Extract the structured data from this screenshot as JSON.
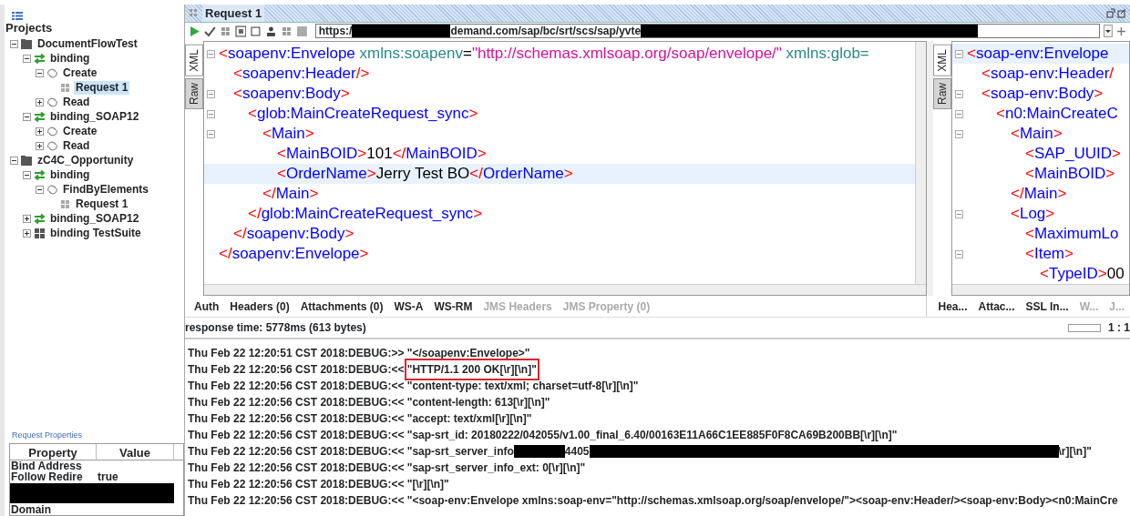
{
  "tree": {
    "title": "Projects",
    "items": [
      {
        "label": "DocumentFlowTest",
        "kind": "project",
        "expanded": true,
        "selected": false,
        "children": [
          {
            "label": "binding",
            "kind": "interface",
            "expanded": true,
            "selected": false,
            "children": [
              {
                "label": "Create",
                "kind": "operation",
                "expanded": true,
                "selected": false,
                "children": [
                  {
                    "label": "Request 1",
                    "kind": "request",
                    "selected": true
                  }
                ]
              },
              {
                "label": "Read",
                "kind": "operation",
                "expanded": false,
                "selected": false
              }
            ]
          },
          {
            "label": "binding_SOAP12",
            "kind": "interface",
            "expanded": true,
            "selected": false,
            "children": [
              {
                "label": "Create",
                "kind": "operation",
                "expanded": false,
                "selected": false
              },
              {
                "label": "Read",
                "kind": "operation",
                "expanded": false,
                "selected": false
              }
            ]
          }
        ]
      },
      {
        "label": "zC4C_Opportunity",
        "kind": "project",
        "expanded": true,
        "selected": false,
        "children": [
          {
            "label": "binding",
            "kind": "interface",
            "expanded": true,
            "selected": false,
            "children": [
              {
                "label": "FindByElements",
                "kind": "operation",
                "expanded": true,
                "selected": false,
                "children": [
                  {
                    "label": "Request 1",
                    "kind": "request",
                    "selected": false
                  }
                ]
              }
            ]
          },
          {
            "label": "binding_SOAP12",
            "kind": "interface",
            "expanded": false,
            "selected": false
          },
          {
            "label": "binding TestSuite",
            "kind": "testsuite",
            "expanded": false,
            "selected": false
          }
        ]
      }
    ]
  },
  "properties": {
    "title": "Request Properties",
    "columns": [
      "Property",
      "Value"
    ],
    "rows": [
      {
        "kind": "row",
        "property": "Bind Address"
      },
      {
        "kind": "row",
        "property": "Follow Redire",
        "value": "true"
      },
      {
        "kind": "redaction"
      },
      {
        "kind": "row",
        "property": "Domain"
      }
    ]
  },
  "request": {
    "title": "Request 1",
    "url": [
      {
        "kind": "text",
        "text": "https:/"
      },
      {
        "kind": "redaction"
      },
      {
        "kind": "text",
        "text": "demand.com/sap/bc/srt/scs/sap/yvte"
      },
      {
        "kind": "redaction"
      }
    ],
    "view_tabs": [
      {
        "label": "XML",
        "selected": true
      },
      {
        "label": "Raw",
        "selected": false
      }
    ],
    "lines": [
      {
        "current": false,
        "tokens": [
          {
            "kind": "bracket",
            "text": "<"
          },
          {
            "kind": "name",
            "text": "soapenv:Envelope"
          },
          {
            "kind": "attr",
            "text": " xmlns:soapenv"
          },
          {
            "kind": "text",
            "text": "="
          },
          {
            "kind": "value",
            "text": "\"http://schemas.xmlsoap.org/soap/envelope/\""
          },
          {
            "kind": "attr",
            "text": " xmlns:glob="
          }
        ],
        "children": [
          {
            "current": false,
            "tokens": [
              {
                "kind": "bracket",
                "text": "<"
              },
              {
                "kind": "name",
                "text": "soapenv:Header"
              },
              {
                "kind": "bracket",
                "text": "/>"
              }
            ]
          },
          {
            "current": false,
            "tokens": [
              {
                "kind": "bracket",
                "text": "<"
              },
              {
                "kind": "name",
                "text": "soapenv:Body"
              },
              {
                "kind": "bracket",
                "text": ">"
              }
            ],
            "children": [
              {
                "current": false,
                "tokens": [
                  {
                    "kind": "bracket",
                    "text": "<"
                  },
                  {
                    "kind": "name",
                    "text": "glob:MainCreateRequest_sync"
                  },
                  {
                    "kind": "bracket",
                    "text": ">"
                  }
                ],
                "children": [
                  {
                    "current": false,
                    "tokens": [
                      {
                        "kind": "bracket",
                        "text": "<"
                      },
                      {
                        "kind": "name",
                        "text": "Main"
                      },
                      {
                        "kind": "bracket",
                        "text": ">"
                      }
                    ],
                    "children": [
                      {
                        "current": false,
                        "tokens": [
                          {
                            "kind": "bracket",
                            "text": "<"
                          },
                          {
                            "kind": "name",
                            "text": "MainBOID"
                          },
                          {
                            "kind": "bracket",
                            "text": ">"
                          },
                          {
                            "kind": "text",
                            "text": "101"
                          },
                          {
                            "kind": "bracket",
                            "text": "</"
                          },
                          {
                            "kind": "name",
                            "text": "MainBOID"
                          },
                          {
                            "kind": "bracket",
                            "text": ">"
                          }
                        ]
                      },
                      {
                        "current": true,
                        "tokens": [
                          {
                            "kind": "bracket",
                            "text": "<"
                          },
                          {
                            "kind": "name",
                            "text": "OrderName"
                          },
                          {
                            "kind": "bracket",
                            "text": ">"
                          },
                          {
                            "kind": "text",
                            "text": "Jerry Test BO"
                          },
                          {
                            "kind": "bracket",
                            "text": "</"
                          },
                          {
                            "kind": "name",
                            "text": "OrderName"
                          },
                          {
                            "kind": "bracket",
                            "text": ">"
                          }
                        ]
                      }
                    ]
                  },
                  {
                    "current": false,
                    "tokens": [
                      {
                        "kind": "bracket",
                        "text": "</"
                      },
                      {
                        "kind": "name",
                        "text": "Main"
                      },
                      {
                        "kind": "bracket",
                        "text": ">"
                      }
                    ]
                  }
                ]
              },
              {
                "current": false,
                "tokens": [
                  {
                    "kind": "bracket",
                    "text": "</"
                  },
                  {
                    "kind": "name",
                    "text": "glob:MainCreateRequest_sync"
                  },
                  {
                    "kind": "bracket",
                    "text": ">"
                  }
                ]
              }
            ]
          },
          {
            "current": false,
            "tokens": [
              {
                "kind": "bracket",
                "text": "</"
              },
              {
                "kind": "name",
                "text": "soapenv:Body"
              },
              {
                "kind": "bracket",
                "text": ">"
              }
            ]
          }
        ]
      },
      {
        "current": false,
        "tokens": [
          {
            "kind": "bracket",
            "text": "</"
          },
          {
            "kind": "name",
            "text": "soapenv:Envelope"
          },
          {
            "kind": "bracket",
            "text": ">"
          }
        ]
      }
    ],
    "tabs": [
      {
        "label": "Auth",
        "disabled": false
      },
      {
        "label": "Headers (0)",
        "disabled": false
      },
      {
        "label": "Attachments (0)",
        "disabled": false
      },
      {
        "label": "WS-A",
        "disabled": false
      },
      {
        "label": "WS-RM",
        "disabled": false
      },
      {
        "label": "JMS Headers",
        "disabled": true
      },
      {
        "label": "JMS Property (0)",
        "disabled": true
      }
    ]
  },
  "response": {
    "view_tabs": [
      {
        "label": "XML",
        "selected": true
      },
      {
        "label": "Raw",
        "selected": false
      }
    ],
    "lines": [
      {
        "current": true,
        "tokens": [
          {
            "kind": "bracket",
            "text": "<"
          },
          {
            "kind": "name",
            "text": "soap-env:Envelope"
          }
        ],
        "children": [
          {
            "current": false,
            "tokens": [
              {
                "kind": "bracket",
                "text": "<"
              },
              {
                "kind": "name",
                "text": "soap-env:Header"
              },
              {
                "kind": "bracket",
                "text": "/"
              }
            ]
          },
          {
            "current": false,
            "tokens": [
              {
                "kind": "bracket",
                "text": "<"
              },
              {
                "kind": "name",
                "text": "soap-env:Body"
              },
              {
                "kind": "bracket",
                "text": ">"
              }
            ],
            "children": [
              {
                "current": false,
                "tokens": [
                  {
                    "kind": "bracket",
                    "text": "<"
                  },
                  {
                    "kind": "name",
                    "text": "n0:MainCreateC"
                  }
                ],
                "children": [
                  {
                    "current": false,
                    "tokens": [
                      {
                        "kind": "bracket",
                        "text": "<"
                      },
                      {
                        "kind": "name",
                        "text": "Main"
                      },
                      {
                        "kind": "bracket",
                        "text": ">"
                      }
                    ],
                    "children": [
                      {
                        "current": false,
                        "tokens": [
                          {
                            "kind": "bracket",
                            "text": "<"
                          },
                          {
                            "kind": "name",
                            "text": "SAP_UUID"
                          },
                          {
                            "kind": "bracket",
                            "text": ">"
                          }
                        ]
                      },
                      {
                        "current": false,
                        "tokens": [
                          {
                            "kind": "bracket",
                            "text": "<"
                          },
                          {
                            "kind": "name",
                            "text": "MainBOID"
                          },
                          {
                            "kind": "bracket",
                            "text": ">"
                          }
                        ]
                      }
                    ]
                  },
                  {
                    "current": false,
                    "tokens": [
                      {
                        "kind": "bracket",
                        "text": "</"
                      },
                      {
                        "kind": "name",
                        "text": "Main"
                      },
                      {
                        "kind": "bracket",
                        "text": ">"
                      }
                    ]
                  },
                  {
                    "current": false,
                    "tokens": [
                      {
                        "kind": "bracket",
                        "text": "<"
                      },
                      {
                        "kind": "name",
                        "text": "Log"
                      },
                      {
                        "kind": "bracket",
                        "text": ">"
                      }
                    ],
                    "children": [
                      {
                        "current": false,
                        "tokens": [
                          {
                            "kind": "bracket",
                            "text": "<"
                          },
                          {
                            "kind": "name",
                            "text": "MaximumLo"
                          }
                        ]
                      },
                      {
                        "current": false,
                        "tokens": [
                          {
                            "kind": "bracket",
                            "text": "<"
                          },
                          {
                            "kind": "name",
                            "text": "Item"
                          },
                          {
                            "kind": "bracket",
                            "text": ">"
                          }
                        ],
                        "children": [
                          {
                            "current": false,
                            "tokens": [
                              {
                                "kind": "bracket",
                                "text": "<"
                              },
                              {
                                "kind": "name",
                                "text": "TypeID"
                              },
                              {
                                "kind": "bracket",
                                "text": ">"
                              },
                              {
                                "kind": "text",
                                "text": "00"
                              }
                            ]
                          }
                        ]
                      }
                    ]
                  }
                ]
              }
            ]
          }
        ]
      }
    ],
    "tabs": [
      {
        "label": "Hea...",
        "disabled": false
      },
      {
        "label": "Attac...",
        "disabled": false
      },
      {
        "label": "SSL In...",
        "disabled": false
      },
      {
        "label": "W...",
        "disabled": true
      },
      {
        "label": "J...",
        "disabled": true
      }
    ],
    "status": "response time: 5778ms (613 bytes)",
    "position": "1 : 1"
  },
  "log": [
    {
      "boxed": false,
      "parts": [
        {
          "kind": "text",
          "text": "Thu Feb 22 12:20:51 CST 2018:DEBUG:>> \"</soapenv:Envelope>\""
        }
      ]
    },
    {
      "boxed": true,
      "parts": [
        {
          "kind": "text",
          "text": "Thu Feb 22 12:20:56 CST 2018:DEBUG:<< "
        },
        {
          "kind": "text",
          "text": "\"HTTP/1.1 200 OK[\\r][\\n]\""
        }
      ]
    },
    {
      "boxed": false,
      "parts": [
        {
          "kind": "text",
          "text": "Thu Feb 22 12:20:56 CST 2018:DEBUG:<< \"content-type: text/xml; charset=utf-8[\\r][\\n]\""
        }
      ]
    },
    {
      "boxed": false,
      "parts": [
        {
          "kind": "text",
          "text": "Thu Feb 22 12:20:56 CST 2018:DEBUG:<< \"content-length: 613[\\r][\\n]\""
        }
      ]
    },
    {
      "boxed": false,
      "parts": [
        {
          "kind": "text",
          "text": "Thu Feb 22 12:20:56 CST 2018:DEBUG:<< \"accept: text/xml[\\r][\\n]\""
        }
      ]
    },
    {
      "boxed": false,
      "parts": [
        {
          "kind": "text",
          "text": "Thu Feb 22 12:20:56 CST 2018:DEBUG:<< \"sap-srt_id: 20180222/042055/v1.00_final_6.40/00163E11A66C1EE885F0F8CA69B200BB[\\r][\\n]\""
        }
      ]
    },
    {
      "boxed": false,
      "parts": [
        {
          "kind": "text",
          "text": "Thu Feb 22 12:20:56 CST 2018:DEBUG:<< \"sap-srt_server_info"
        },
        {
          "kind": "redaction"
        },
        {
          "kind": "text",
          "text": "4405"
        },
        {
          "kind": "redaction"
        },
        {
          "kind": "text",
          "text": "\\r][\\n]\""
        }
      ]
    },
    {
      "boxed": false,
      "parts": [
        {
          "kind": "text",
          "text": "Thu Feb 22 12:20:56 CST 2018:DEBUG:<< \"sap-srt_server_info_ext: 0[\\r][\\n]\""
        }
      ]
    },
    {
      "boxed": false,
      "parts": [
        {
          "kind": "text",
          "text": "Thu Feb 22 12:20:56 CST 2018:DEBUG:<< \"[\\r][\\n]\""
        }
      ]
    },
    {
      "boxed": false,
      "parts": [
        {
          "kind": "text",
          "text": "Thu Feb 22 12:20:56 CST 2018:DEBUG:<< \"<soap-env:Envelope xmlns:soap-env=\"http://schemas.xmlsoap.org/soap/envelope/\"><soap-env:Header/><soap-env:Body><n0:MainCre"
        }
      ]
    }
  ]
}
